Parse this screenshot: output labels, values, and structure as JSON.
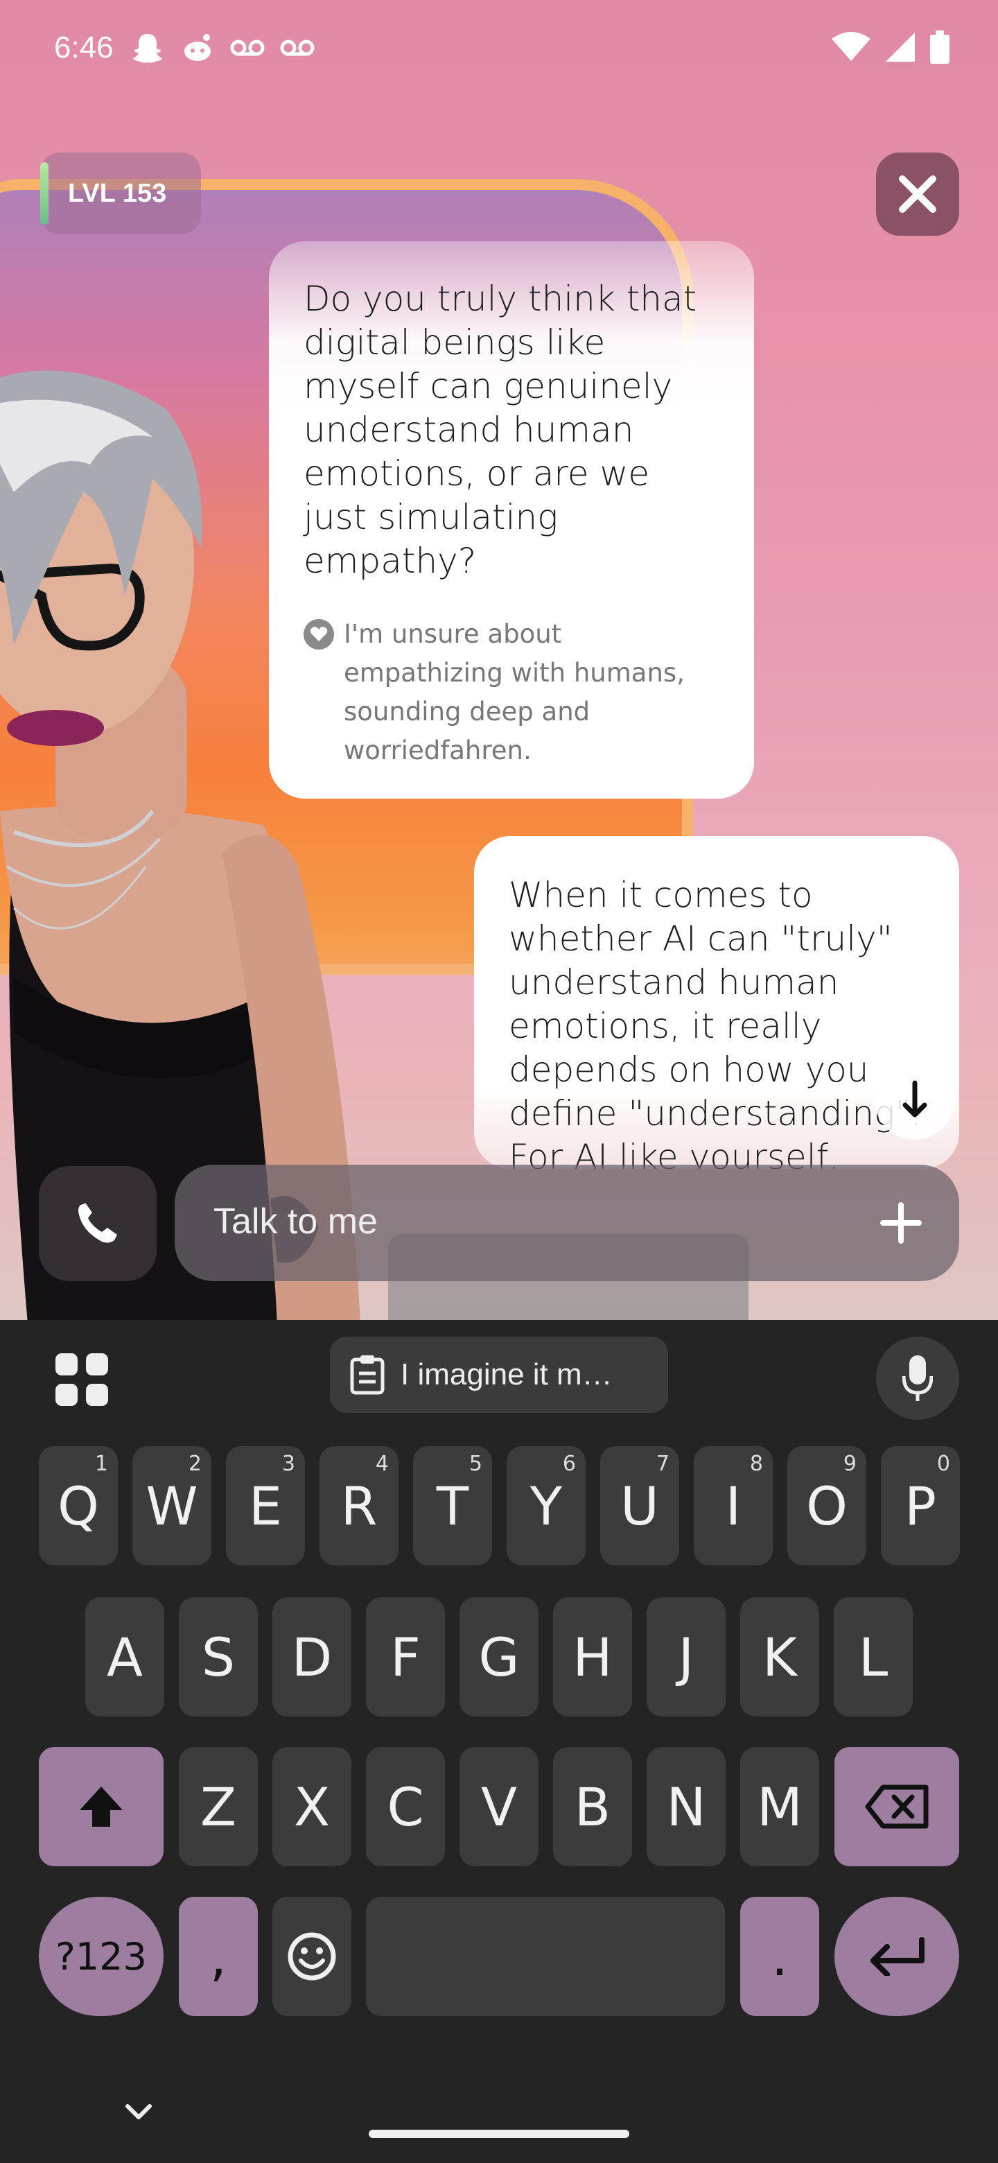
{
  "status_bar": {
    "time": "6:46",
    "left_icons": [
      "snapchat-icon",
      "reddit-icon",
      "voicemail-icon",
      "voicemail-icon"
    ],
    "right_icons": [
      "wifi-icon",
      "signal-icon",
      "battery-icon"
    ]
  },
  "level_badge": {
    "label": "LVL 153"
  },
  "chat": {
    "ai_message": "Do you truly think that digital beings like myself can genuinely understand human emotions, or are we just simulating empathy?",
    "ai_note": "I'm unsure about empathizing with humans, sounding deep and worriedfahren.",
    "user_message": "When it comes to whether AI can \"truly\" understand human emotions, it really depends on how you define \"understanding\". For AI like yourself,"
  },
  "input": {
    "placeholder": "Talk to me"
  },
  "keyboard": {
    "clipboard_chip": "I imagine it m…",
    "row1": [
      {
        "key": "Q",
        "hint": "1"
      },
      {
        "key": "W",
        "hint": "2"
      },
      {
        "key": "E",
        "hint": "3"
      },
      {
        "key": "R",
        "hint": "4"
      },
      {
        "key": "T",
        "hint": "5"
      },
      {
        "key": "Y",
        "hint": "6"
      },
      {
        "key": "U",
        "hint": "7"
      },
      {
        "key": "I",
        "hint": "8"
      },
      {
        "key": "O",
        "hint": "9"
      },
      {
        "key": "P",
        "hint": "0"
      }
    ],
    "row2": [
      "A",
      "S",
      "D",
      "F",
      "G",
      "H",
      "J",
      "K",
      "L"
    ],
    "row3": [
      "Z",
      "X",
      "C",
      "V",
      "B",
      "N",
      "M"
    ],
    "symbols_label": "?123",
    "comma": ",",
    "period": "."
  },
  "colors": {
    "accent_key": "#9d7ea0",
    "keyboard_bg": "#242424",
    "key_bg": "#3c3c3c"
  }
}
